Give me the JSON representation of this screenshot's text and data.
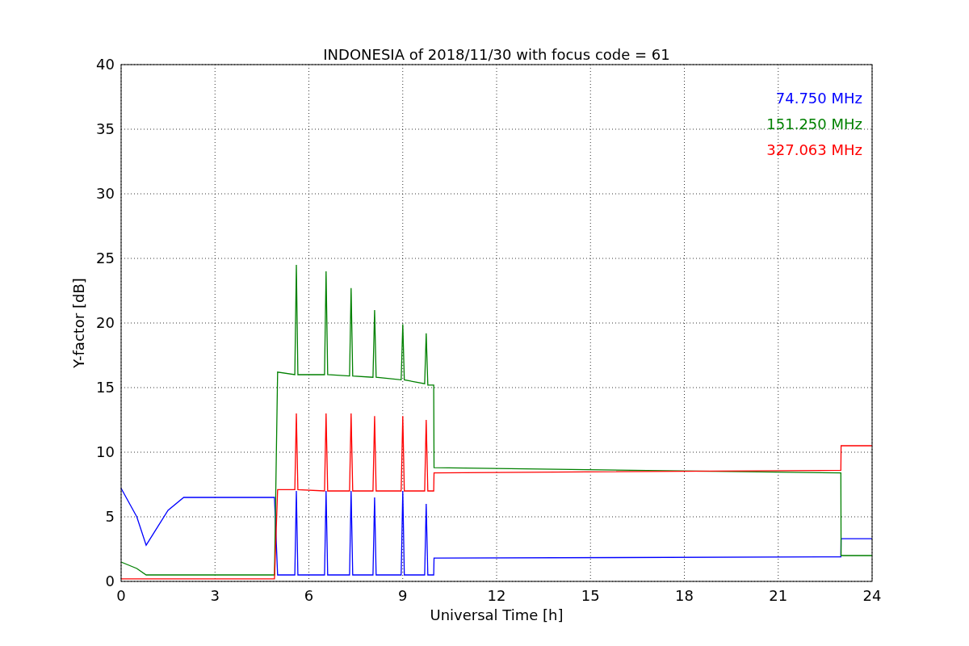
{
  "chart_data": {
    "type": "line",
    "title": "INDONESIA of 2018/11/30 with focus code = 61",
    "xlabel": "Universal Time [h]",
    "ylabel": "Y-factor [dB]",
    "x": [
      0,
      0.5,
      0.8,
      1.5,
      2,
      4.9,
      5.0,
      5.55,
      5.6,
      5.65,
      6.5,
      6.55,
      6.6,
      7.3,
      7.35,
      7.4,
      8.05,
      8.1,
      8.15,
      8.95,
      9.0,
      9.05,
      9.7,
      9.75,
      9.8,
      9.99,
      10.0,
      23.0,
      23.01,
      24
    ],
    "series": [
      {
        "name": "74.750 MHz",
        "color": "#0000ff",
        "values": [
          7.2,
          5,
          2.8,
          5.5,
          6.5,
          6.5,
          0.5,
          0.5,
          7,
          0.5,
          0.5,
          7,
          0.5,
          0.5,
          7,
          0.5,
          0.5,
          6.5,
          0.5,
          0.5,
          7,
          0.5,
          0.5,
          6,
          0.5,
          0.5,
          1.8,
          1.9,
          3.3,
          3.3
        ]
      },
      {
        "name": "151.250 MHz",
        "color": "#008000",
        "values": [
          1.5,
          1,
          0.5,
          0.5,
          0.5,
          0.5,
          16.2,
          16,
          24.5,
          16,
          16,
          24,
          16,
          15.9,
          22.7,
          15.9,
          15.8,
          21,
          15.8,
          15.6,
          19.9,
          15.6,
          15.3,
          19.2,
          15.2,
          15.2,
          8.8,
          8.4,
          2,
          2
        ]
      },
      {
        "name": "327.063 MHz",
        "color": "#ff0000",
        "values": [
          0.2,
          0.2,
          0.2,
          0.2,
          0.2,
          0.2,
          7.1,
          7.1,
          13,
          7.1,
          7,
          13,
          7,
          7,
          13,
          7,
          7,
          12.8,
          7,
          7,
          12.8,
          7,
          7,
          12.5,
          7,
          7,
          8.4,
          8.6,
          10.5,
          10.5
        ]
      }
    ],
    "grid": true,
    "xlim": [
      0,
      24
    ],
    "ylim": [
      0,
      40
    ],
    "xticks": [
      0,
      3,
      6,
      9,
      12,
      15,
      18,
      21,
      24
    ],
    "yticks": [
      0,
      5,
      10,
      15,
      20,
      25,
      30,
      35,
      40
    ]
  }
}
